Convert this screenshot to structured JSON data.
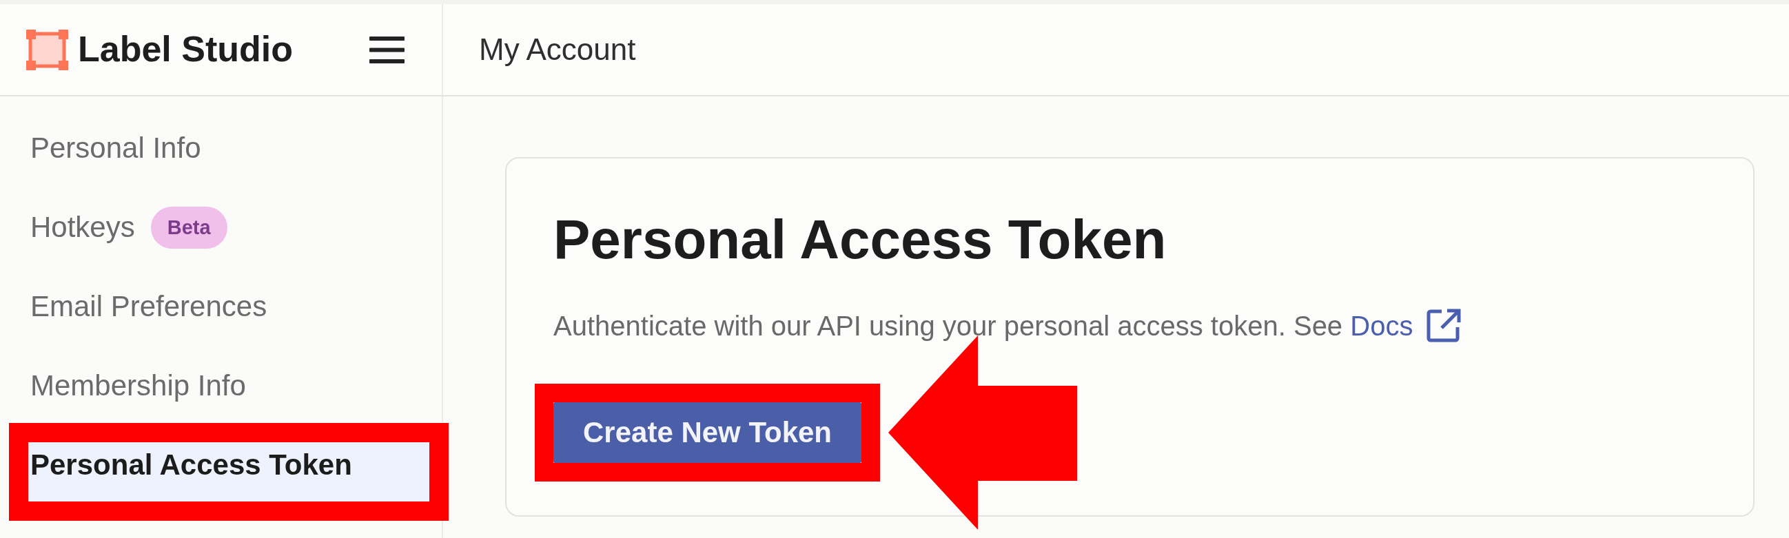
{
  "header": {
    "logo_text": "Label Studio",
    "page_title": "My Account"
  },
  "sidebar": {
    "items": [
      {
        "label": "Personal Info",
        "selected": false,
        "highlighted": false
      },
      {
        "label": "Hotkeys",
        "badge": "Beta",
        "selected": false,
        "highlighted": false
      },
      {
        "label": "Email Preferences",
        "selected": false,
        "highlighted": false
      },
      {
        "label": "Membership Info",
        "selected": false,
        "highlighted": false
      },
      {
        "label": "Personal Access Token",
        "selected": true,
        "highlighted": true
      }
    ]
  },
  "card": {
    "title": "Personal Access Token",
    "description": "Authenticate with our API using your personal access token. See",
    "link": {
      "label": "Docs",
      "external": true
    },
    "button": {
      "label": "Create New Token",
      "highlighted": true,
      "arrow": true
    }
  }
}
